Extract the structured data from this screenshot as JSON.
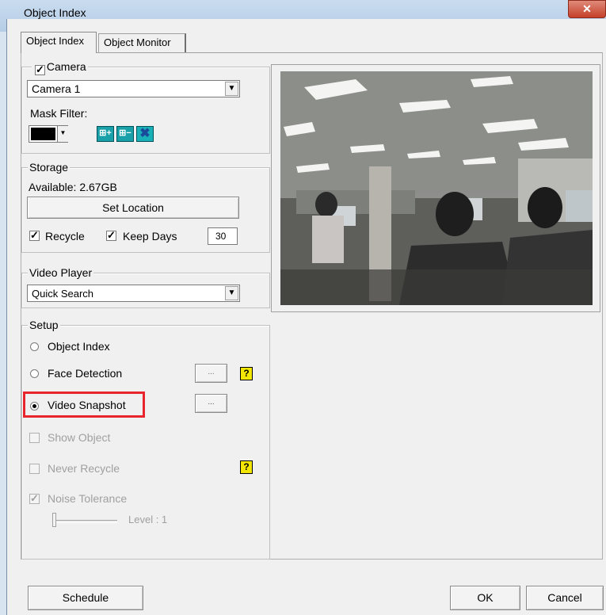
{
  "window": {
    "title": "Object Index",
    "close_glyph": "✕"
  },
  "tabs": [
    {
      "label": "Object Index",
      "active": true
    },
    {
      "label": "Object Monitor",
      "active": false
    }
  ],
  "camera": {
    "group_label": "Camera",
    "checked": true,
    "selected": "Camera 1",
    "mask_filter_label": "Mask Filter:",
    "mask_buttons": [
      "add-mask-icon",
      "remove-mask-icon",
      "clear-mask-icon"
    ]
  },
  "storage": {
    "group_label": "Storage",
    "available": "Available: 2.67GB",
    "set_location": "Set Location",
    "recycle_label": "Recycle",
    "recycle_checked": true,
    "keep_days_label": "Keep Days",
    "keep_days_checked": true,
    "keep_days_value": "30"
  },
  "video_player": {
    "group_label": "Video Player",
    "selected": "Quick Search"
  },
  "setup": {
    "group_label": "Setup",
    "mode": "Video Snapshot",
    "object_index": "Object Index",
    "face_detection": "Face Detection",
    "video_snapshot": "Video Snapshot",
    "more_button": "...",
    "help_glyph": "?",
    "show_object": "Show Object",
    "never_recycle": "Never Recycle",
    "noise_tolerance": "Noise Tolerance",
    "noise_checked": true,
    "level_label": "Level : 1",
    "level_value": 1
  },
  "footer": {
    "schedule": "Schedule",
    "ok": "OK",
    "cancel": "Cancel"
  },
  "colors": {
    "highlight": "#e8252c",
    "help_badge": "#f3e600",
    "mask_buttons": "#1aa0a8"
  }
}
